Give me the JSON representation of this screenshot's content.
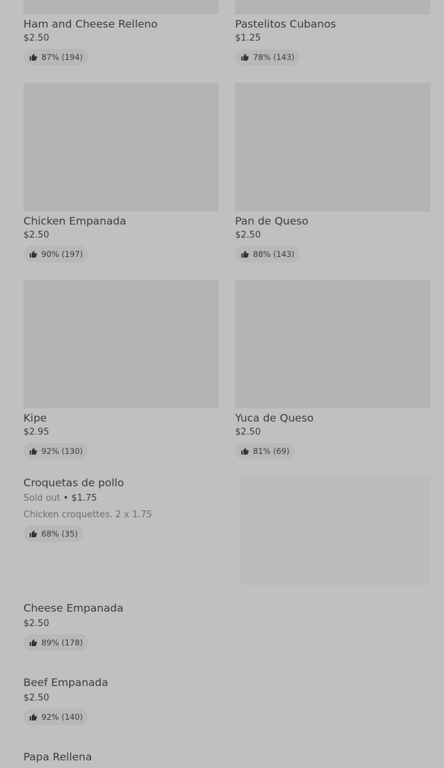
{
  "grid_items": [
    {
      "name": "Ham and Cheese Relleno",
      "price": "$2.50",
      "rating": "87% (194)"
    },
    {
      "name": "Pastelitos Cubanos",
      "price": "$1.25",
      "rating": "78% (143)"
    },
    {
      "name": "Chicken Empanada",
      "price": "$2.50",
      "rating": "90% (197)"
    },
    {
      "name": "Pan de Queso",
      "price": "$2.50",
      "rating": "88% (143)"
    },
    {
      "name": "Kipe",
      "price": "$2.95",
      "rating": "92% (130)"
    },
    {
      "name": "Yuca de Queso",
      "price": "$2.50",
      "rating": "81% (69)"
    }
  ],
  "list_items": [
    {
      "name": "Croquetas de pollo",
      "sold_out": "Sold out",
      "separator": "•",
      "price": "$1.75",
      "description": "Chicken croquettes. 2 x 1.75",
      "rating": "68% (35)"
    },
    {
      "name": "Cheese Empanada",
      "price": "$2.50",
      "rating": "89% (178)"
    },
    {
      "name": "Beef Empanada",
      "price": "$2.50",
      "rating": "92% (140)"
    },
    {
      "name": "Papa Rellena"
    }
  ],
  "icons": {
    "rating": "thumbs-up-icon"
  }
}
